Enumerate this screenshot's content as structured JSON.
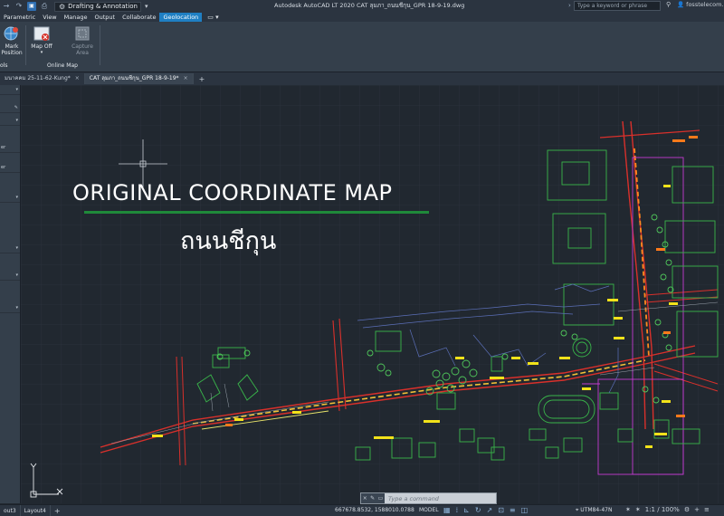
{
  "titlebar": {
    "workspace": "Drafting & Annotation",
    "app_title": "Autodesk AutoCAD LT 2020   CAT ลุมภา_ถนนชีกุน_GPR 18-9-19.dwg",
    "search_placeholder": "Type a keyword or phrase",
    "user": "fosstelecom..."
  },
  "ribbon_tabs": [
    "Parametric",
    "View",
    "Manage",
    "Output",
    "Collaborate",
    "Geolocation"
  ],
  "active_tab": "Geolocation",
  "ribbon": {
    "mark_position_label": "Mark\nPosition",
    "tools_panel_label": "ols",
    "map_off_label": "Map Off",
    "capture_area_label": "Capture\nArea",
    "online_map_label": "Online Map"
  },
  "file_tabs": [
    {
      "label": "มนาคคม 25-11-62-Kung*",
      "active": false
    },
    {
      "label": "CAT ลุมภา_ถนนชีกุน_GPR 18-9-19*",
      "active": true
    }
  ],
  "left_panel": [
    {
      "text": "",
      "chev": "▾"
    },
    {
      "text": "",
      "chev": "▾"
    },
    {
      "text": "er",
      "chev": ""
    },
    {
      "text": "er",
      "chev": ""
    },
    {
      "text": "",
      "chev": "▾"
    },
    {
      "text": "",
      "chev": "▾"
    },
    {
      "text": "",
      "chev": "▾"
    },
    {
      "text": "",
      "chev": "▾"
    }
  ],
  "overlay": {
    "title": "ORIGINAL COORDINATE MAP",
    "subtitle": "ถนนชีกุน"
  },
  "command": {
    "placeholder": "Type a command"
  },
  "status": {
    "layout_tabs": [
      "out3",
      "Layout4"
    ],
    "coordinates": "667678.8532, 1588010.0788",
    "space": "MODEL",
    "coord_system": "UTM84-47N",
    "scale": "1:1 / 100%"
  },
  "colors": {
    "canvas_bg": "#212830",
    "accent_tab": "#1f7fc3",
    "underline": "#1f8a3a"
  }
}
